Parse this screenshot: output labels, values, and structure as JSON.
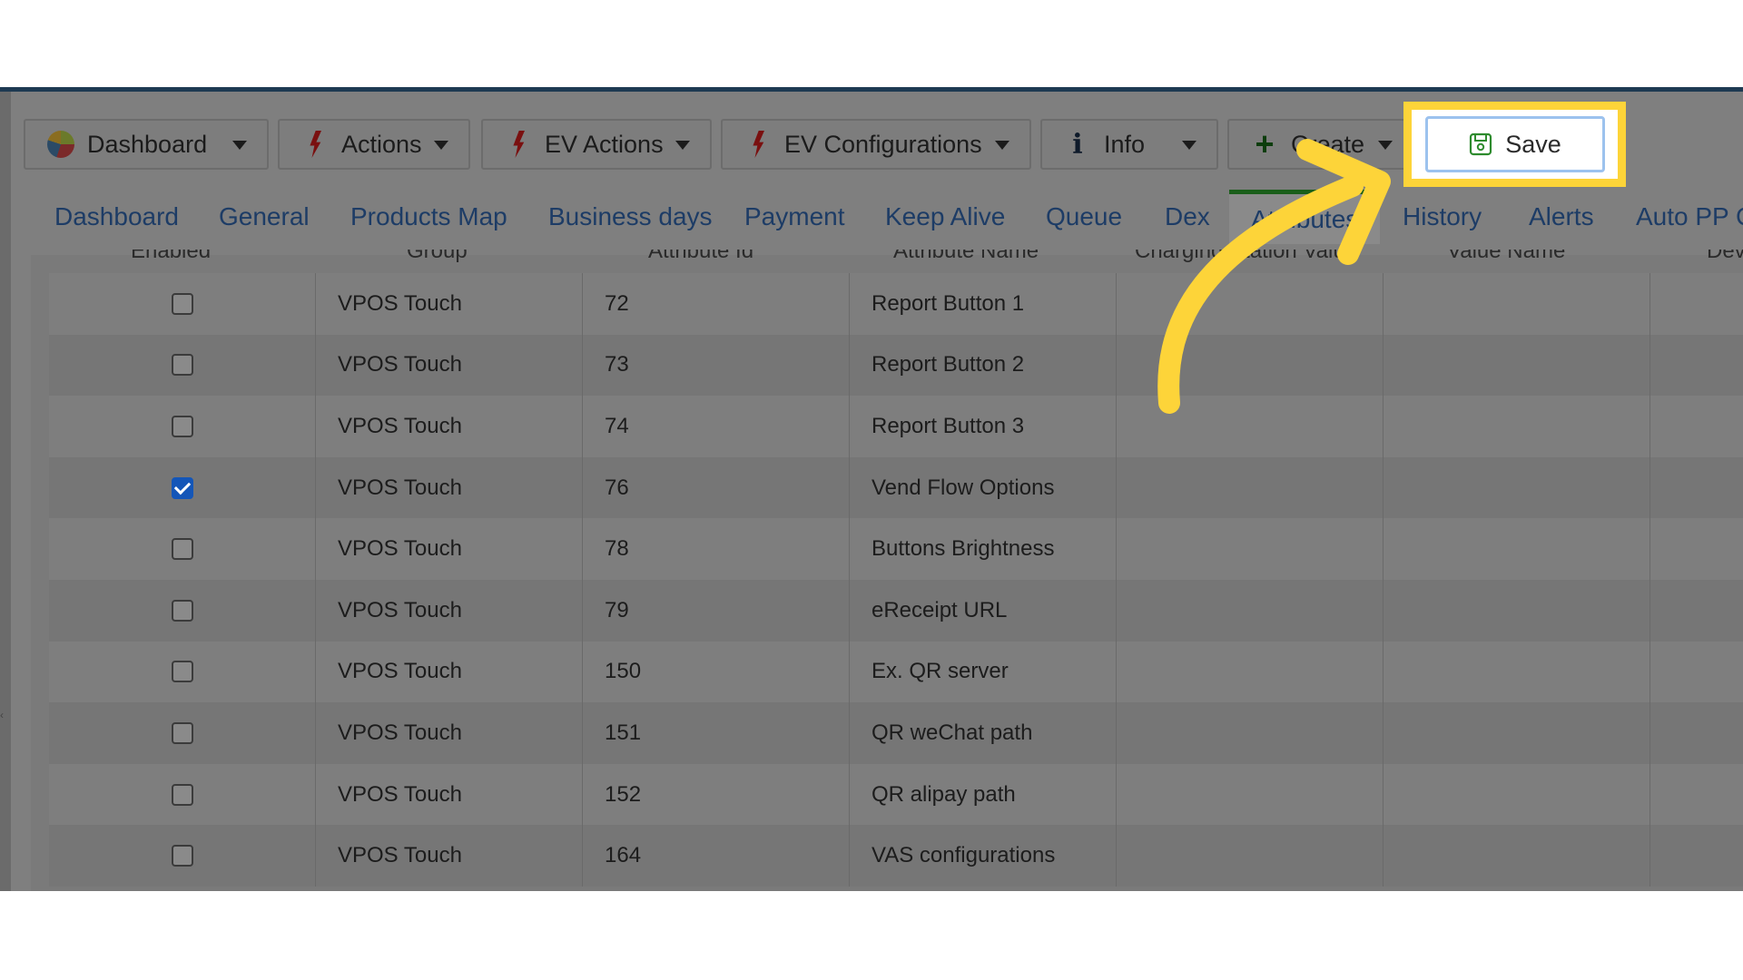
{
  "toolbar": {
    "dashboard": "Dashboard",
    "actions": "Actions",
    "ev_actions": "EV Actions",
    "ev_configurations": "EV Configurations",
    "info": "Info",
    "create": "Create",
    "save": "Save"
  },
  "tabs": [
    "Dashboard",
    "General",
    "Products Map",
    "Business days",
    "Payment",
    "Keep Alive",
    "Queue",
    "Dex",
    "Attributes",
    "History",
    "Alerts",
    "Auto PP C"
  ],
  "active_tab": "Attributes",
  "columns": [
    "Enabled",
    "Group",
    "Attribute Id",
    "Attribute Name",
    "Charging Station Value",
    "Value Name",
    "Dev"
  ],
  "rows": [
    {
      "enabled": false,
      "group": "VPOS Touch",
      "id": "72",
      "name": "Report Button 1"
    },
    {
      "enabled": false,
      "group": "VPOS Touch",
      "id": "73",
      "name": "Report Button 2"
    },
    {
      "enabled": false,
      "group": "VPOS Touch",
      "id": "74",
      "name": "Report Button 3"
    },
    {
      "enabled": true,
      "group": "VPOS Touch",
      "id": "76",
      "name": "Vend Flow Options"
    },
    {
      "enabled": false,
      "group": "VPOS Touch",
      "id": "78",
      "name": "Buttons Brightness"
    },
    {
      "enabled": false,
      "group": "VPOS Touch",
      "id": "79",
      "name": "eReceipt URL"
    },
    {
      "enabled": false,
      "group": "VPOS Touch",
      "id": "150",
      "name": "Ex. QR server"
    },
    {
      "enabled": false,
      "group": "VPOS Touch",
      "id": "151",
      "name": "QR weChat path"
    },
    {
      "enabled": false,
      "group": "VPOS Touch",
      "id": "152",
      "name": "QR alipay path"
    },
    {
      "enabled": false,
      "group": "VPOS Touch",
      "id": "164",
      "name": "VAS configurations"
    }
  ],
  "colors": {
    "highlight": "#fdd439",
    "arrow": "#fdd439",
    "link": "#1d3c66",
    "checkbox": "#1456b8"
  }
}
